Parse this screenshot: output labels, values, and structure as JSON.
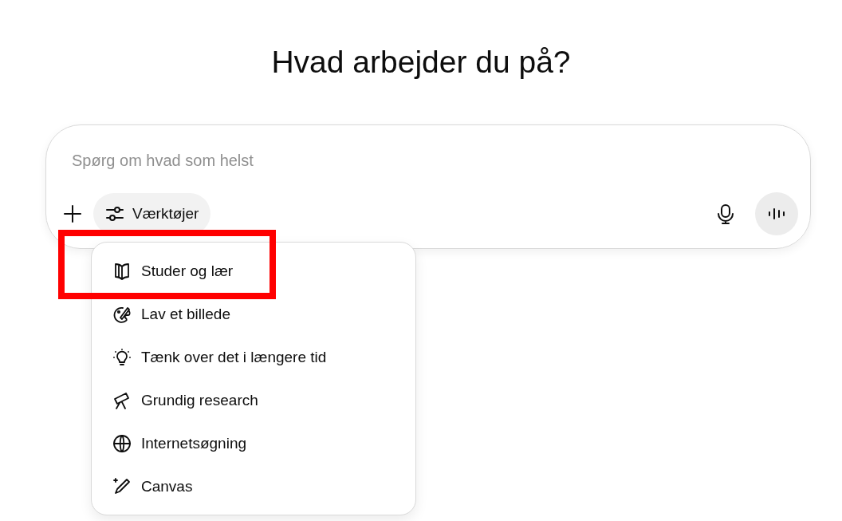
{
  "heading": "Hvad arbejder du på?",
  "composer": {
    "placeholder": "Spørg om hvad som helst",
    "tools_button": "Værktøjer"
  },
  "menu": {
    "expanded": true,
    "items": [
      {
        "kind": "book",
        "label": "Studer og lær",
        "highlighted": true
      },
      {
        "kind": "palette",
        "label": "Lav et billede",
        "highlighted": false
      },
      {
        "kind": "bulb",
        "label": "Tænk over det i længere tid",
        "highlighted": false
      },
      {
        "kind": "telescope",
        "label": "Grundig research",
        "highlighted": false
      },
      {
        "kind": "globe",
        "label": "Internetsøgning",
        "highlighted": false
      },
      {
        "kind": "pen",
        "label": "Canvas",
        "highlighted": false
      }
    ]
  }
}
